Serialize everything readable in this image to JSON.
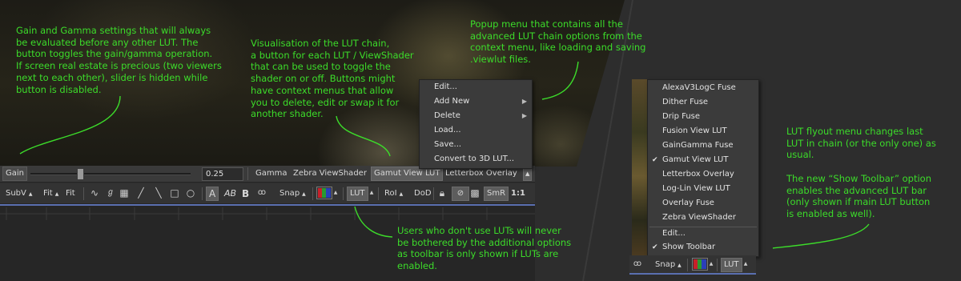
{
  "viewer_toolbar": {
    "gain_label": "Gain",
    "gain_value": "0.25",
    "gain_slider_value": 0.25,
    "lut_chain": [
      "Gamma",
      "Zebra ViewShader",
      "Gamut View LUT",
      "Letterbox Overlay"
    ],
    "chain_menu_arrow": "▲"
  },
  "main_toolbar": {
    "subv_label": "SubV",
    "fit_label": "Fit",
    "fit2_label": "Fit",
    "snap_label": "Snap",
    "lut_label": "LUT",
    "roi_label": "RoI",
    "dod_label": "DoD",
    "smr_label": "SmR",
    "one_to_one_label": "1:1",
    "text_a_label": "A",
    "text_ab_label": "AB",
    "text_b_label": "B"
  },
  "popup_menu": {
    "items": [
      {
        "label": "Edit...",
        "submenu": false
      },
      {
        "label": "Add New",
        "submenu": true
      },
      {
        "label": "Delete",
        "submenu": true
      },
      {
        "label": "Load...",
        "submenu": false
      },
      {
        "label": "Save...",
        "submenu": false
      },
      {
        "label": "Convert to 3D LUT...",
        "submenu": false
      }
    ]
  },
  "flyout_menu": {
    "items": [
      {
        "label": "AlexaV3LogC Fuse",
        "checked": false
      },
      {
        "label": "Dither Fuse",
        "checked": false
      },
      {
        "label": "Drip Fuse",
        "checked": false
      },
      {
        "label": "Fusion View LUT",
        "checked": false
      },
      {
        "label": "GainGamma Fuse",
        "checked": false
      },
      {
        "label": "Gamut View LUT",
        "checked": true
      },
      {
        "label": "Letterbox Overlay",
        "checked": false
      },
      {
        "label": "Log-Lin View LUT",
        "checked": false
      },
      {
        "label": "Overlay Fuse",
        "checked": false
      },
      {
        "label": "Zebra ViewShader",
        "checked": false
      }
    ],
    "footer_items": [
      {
        "label": "Edit...",
        "checked": false
      },
      {
        "label": "Show Toolbar",
        "checked": true
      }
    ],
    "check_glyph": "✔"
  },
  "right_toolbar": {
    "snap_label": "Snap",
    "lut_label": "LUT",
    "arrow": "▲"
  },
  "annotations": {
    "gain_gamma": "Gain and Gamma settings that will always\nbe evaluated before any other LUT. The\nbutton toggles the gain/gamma operation.\nIf screen real estate is precious (two viewers\nnext to each other), slider is hidden while\nbutton is disabled.",
    "lut_chain": "Visualisation of the LUT chain,\na button for each LUT / ViewShader\nthat can be used to toggle the\nshader on or off. Buttons might\nhave context menus that allow\nyou to delete, edit or swap it for\nanother shader.",
    "popup_menu": "Popup menu that contains all the\nadvanced LUT chain options from the\ncontext menu, like loading and saving\n.viewlut files.",
    "no_luts": "Users who don't use LUTs will never\nbe bothered by the additional options\nas toolbar is only shown if LUTs are\nenabled.",
    "flyout": "LUT flyout menu changes last\nLUT in chain (or the only one) as\nusual.\n\nThe new “Show Toolbar” option\nenables the advanced LUT bar\n(only shown if main LUT button\nis enabled as well)."
  },
  "colors": {
    "annotation": "#3cdc2a",
    "accent_line": "#5a6fb0"
  }
}
